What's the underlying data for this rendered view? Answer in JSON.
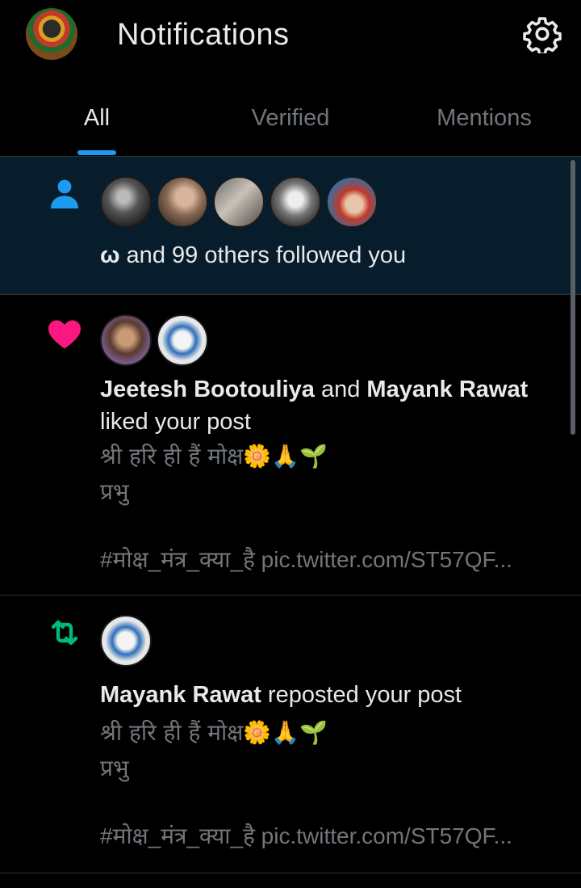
{
  "header": {
    "title": "Notifications"
  },
  "tabs": [
    {
      "label": "All",
      "active": true
    },
    {
      "label": "Verified",
      "active": false
    },
    {
      "label": "Mentions",
      "active": false
    }
  ],
  "notifications": [
    {
      "type": "follow",
      "icon": "person-icon",
      "actor": "ω",
      "text": " and 99 others followed you"
    },
    {
      "type": "like",
      "icon": "heart-icon",
      "actor1": "Jeetesh Bootouliya",
      "conj": " and ",
      "actor2": "Mayank Rawat",
      "action": "liked your post",
      "post_line1": "श्री हरि ही हैं मोक्ष🌼🙏🌱",
      "post_line2": "प्रभु",
      "post_line3": "#मोक्ष_मंत्र_क्या_है pic.twitter.com/ST57QF..."
    },
    {
      "type": "repost",
      "icon": "repost-icon",
      "actor": "Mayank Rawat",
      "action": " reposted your post",
      "post_line1": "श्री हरि ही हैं मोक्ष🌼🙏🌱",
      "post_line2": "प्रभु",
      "post_line3": "#मोक्ष_मंत्र_क्या_है pic.twitter.com/ST57QF..."
    }
  ],
  "colors": {
    "accent": "#1d9bf0",
    "like": "#f91880",
    "repost": "#00ba7c"
  }
}
